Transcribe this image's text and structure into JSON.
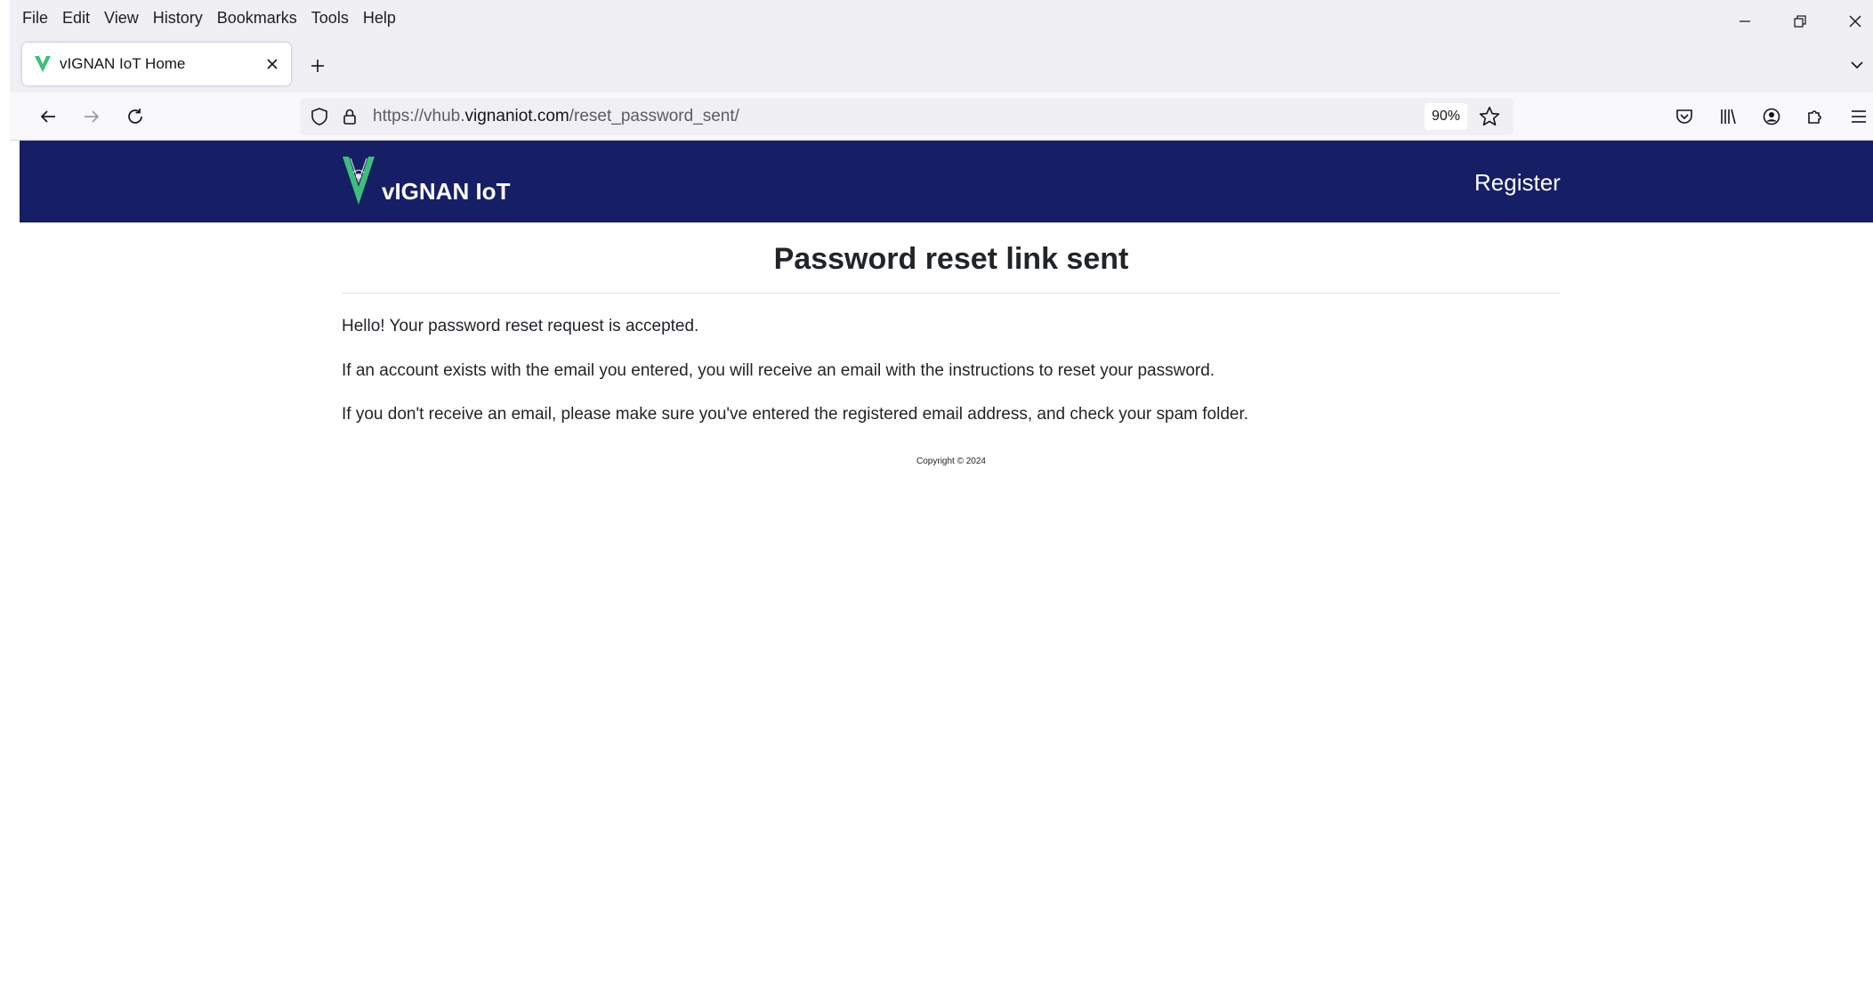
{
  "menu": {
    "file": "File",
    "edit": "Edit",
    "view": "View",
    "history": "History",
    "bookmarks": "Bookmarks",
    "tools": "Tools",
    "help": "Help"
  },
  "tab": {
    "title": "vIGNAN IoT Home"
  },
  "urlbar": {
    "prefix": "https://vhub.",
    "domain": "vignaniot.com",
    "path": "/reset_password_sent/",
    "zoom": "90%"
  },
  "site": {
    "brand": "vIGNAN IoT",
    "register": "Register",
    "heading": "Password reset link sent",
    "paragraphs": [
      "Hello! Your password reset request is accepted.",
      "If an account exists with the email you entered, you will receive an email with the instructions to reset your password.",
      "If you don't receive an email, please make sure you've entered the registered email address, and check your spam folder."
    ],
    "copyright": "Copyright © 2024"
  },
  "colors": {
    "header_bg": "#161e66",
    "logo_green": "#3dbf7a"
  }
}
